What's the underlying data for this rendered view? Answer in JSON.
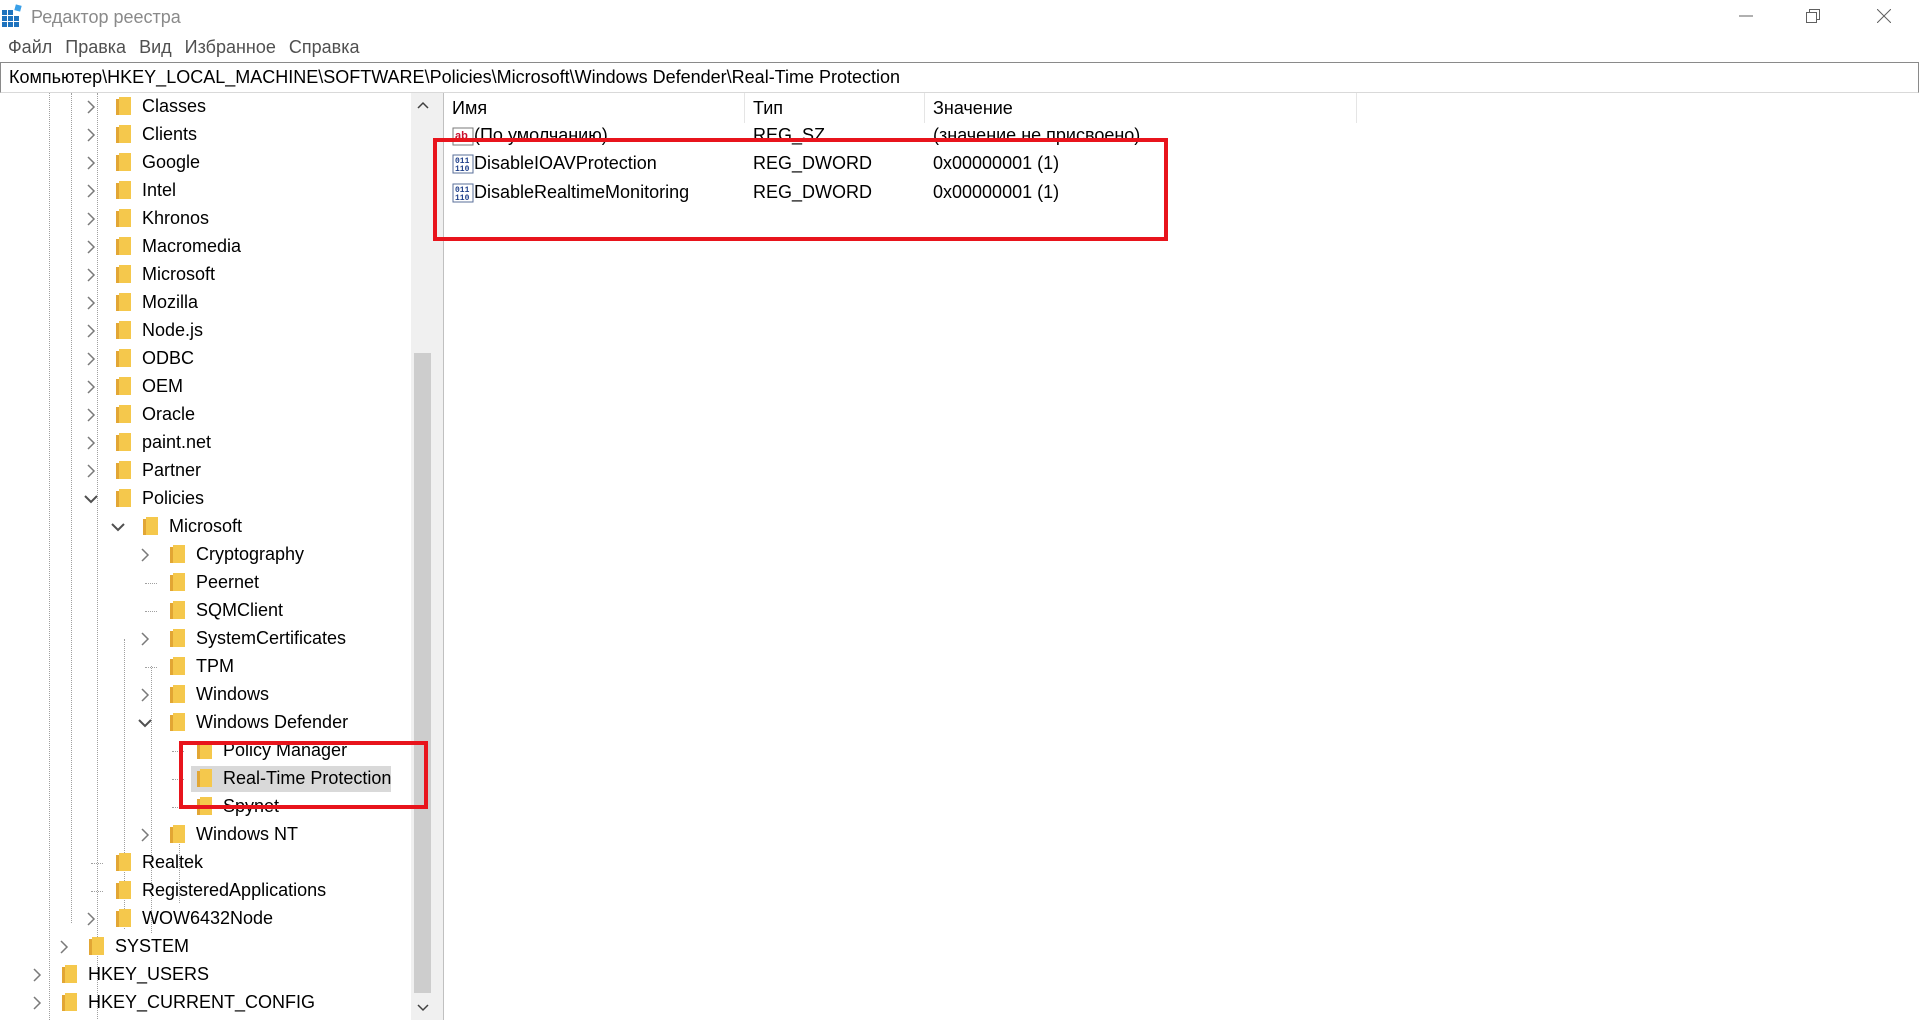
{
  "window": {
    "title": "Редактор реестра"
  },
  "menu": [
    "Файл",
    "Правка",
    "Вид",
    "Избранное",
    "Справка"
  ],
  "address": "Компьютер\\HKEY_LOCAL_MACHINE\\SOFTWARE\\Policies\\Microsoft\\Windows Defender\\Real-Time Protection",
  "tree": [
    {
      "label": "Classes",
      "depth": 3,
      "expander": "collapsed"
    },
    {
      "label": "Clients",
      "depth": 3,
      "expander": "collapsed"
    },
    {
      "label": "Google",
      "depth": 3,
      "expander": "collapsed"
    },
    {
      "label": "Intel",
      "depth": 3,
      "expander": "collapsed"
    },
    {
      "label": "Khronos",
      "depth": 3,
      "expander": "collapsed"
    },
    {
      "label": "Macromedia",
      "depth": 3,
      "expander": "collapsed"
    },
    {
      "label": "Microsoft",
      "depth": 3,
      "expander": "collapsed"
    },
    {
      "label": "Mozilla",
      "depth": 3,
      "expander": "collapsed"
    },
    {
      "label": "Node.js",
      "depth": 3,
      "expander": "collapsed"
    },
    {
      "label": "ODBC",
      "depth": 3,
      "expander": "collapsed"
    },
    {
      "label": "OEM",
      "depth": 3,
      "expander": "collapsed"
    },
    {
      "label": "Oracle",
      "depth": 3,
      "expander": "collapsed"
    },
    {
      "label": "paint.net",
      "depth": 3,
      "expander": "collapsed"
    },
    {
      "label": "Partner",
      "depth": 3,
      "expander": "collapsed"
    },
    {
      "label": "Policies",
      "depth": 3,
      "expander": "expanded"
    },
    {
      "label": "Microsoft",
      "depth": 4,
      "expander": "expanded"
    },
    {
      "label": "Cryptography",
      "depth": 5,
      "expander": "collapsed"
    },
    {
      "label": "Peernet",
      "depth": 5,
      "expander": "none"
    },
    {
      "label": "SQMClient",
      "depth": 5,
      "expander": "none"
    },
    {
      "label": "SystemCertificates",
      "depth": 5,
      "expander": "collapsed"
    },
    {
      "label": "TPM",
      "depth": 5,
      "expander": "none"
    },
    {
      "label": "Windows",
      "depth": 5,
      "expander": "collapsed"
    },
    {
      "label": "Windows Defender",
      "depth": 5,
      "expander": "expanded"
    },
    {
      "label": "Policy Manager",
      "depth": 6,
      "expander": "none"
    },
    {
      "label": "Real-Time Protection",
      "depth": 6,
      "expander": "none",
      "selected": true
    },
    {
      "label": "Spynet",
      "depth": 6,
      "expander": "none"
    },
    {
      "label": "Windows NT",
      "depth": 5,
      "expander": "collapsed"
    },
    {
      "label": "Realtek",
      "depth": 3,
      "expander": "none"
    },
    {
      "label": "RegisteredApplications",
      "depth": 3,
      "expander": "none"
    },
    {
      "label": "WOW6432Node",
      "depth": 3,
      "expander": "collapsed"
    },
    {
      "label": "SYSTEM",
      "depth": 2,
      "expander": "collapsed"
    },
    {
      "label": "HKEY_USERS",
      "depth": 1,
      "expander": "collapsed"
    },
    {
      "label": "HKEY_CURRENT_CONFIG",
      "depth": 1,
      "expander": "collapsed"
    }
  ],
  "list": {
    "columns": [
      "Имя",
      "Тип",
      "Значение"
    ],
    "rows": [
      {
        "name": "(По умолчанию)",
        "type": "REG_SZ",
        "value": "(значение не присвоено)",
        "icon": "string-value-icon"
      },
      {
        "name": "DisableIOAVProtection",
        "type": "REG_DWORD",
        "value": "0x00000001 (1)",
        "icon": "binary-value-icon"
      },
      {
        "name": "DisableRealtimeMonitoring",
        "type": "REG_DWORD",
        "value": "0x00000001 (1)",
        "icon": "binary-value-icon"
      }
    ]
  },
  "colors": {
    "highlight": "#e8141c",
    "folder": "#f5c84c",
    "selection": "#d9d9d9"
  }
}
